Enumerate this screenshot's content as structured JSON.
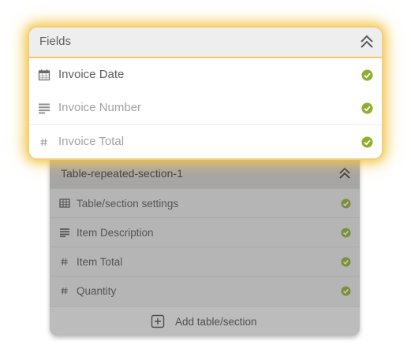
{
  "colors": {
    "check_green": "#8dae2e",
    "check_green_dim": "#7c8f3c",
    "highlight_glow": "#f2c444",
    "panel_dim": "#b9b9b9"
  },
  "fields_panel": {
    "title": "Fields",
    "collapse_icon": "double-chevron-up-icon",
    "rows": [
      {
        "label": "Invoice Date",
        "icon": "calendar-icon",
        "status_icon": "check-circle-icon",
        "selected": true
      },
      {
        "label": "Invoice Number",
        "icon": "text-lines-icon",
        "status_icon": "check-circle-icon",
        "selected": false
      },
      {
        "label": "Invoice Total",
        "icon": "hash-icon",
        "status_icon": "check-circle-icon",
        "selected": false
      }
    ]
  },
  "table_panel": {
    "title": "Table-repeated-section-1",
    "collapse_icon": "double-chevron-up-icon",
    "rows": [
      {
        "label": "Table/section settings",
        "icon": "table-grid-icon",
        "status_icon": "check-circle-icon"
      },
      {
        "label": "Item Description",
        "icon": "text-lines-icon",
        "status_icon": "check-circle-icon"
      },
      {
        "label": "Item Total",
        "icon": "hash-icon",
        "status_icon": "check-circle-icon"
      },
      {
        "label": "Quantity",
        "icon": "hash-icon",
        "status_icon": "check-circle-icon"
      }
    ],
    "add_label": "Add table/section",
    "add_icon": "plus-square-icon"
  }
}
